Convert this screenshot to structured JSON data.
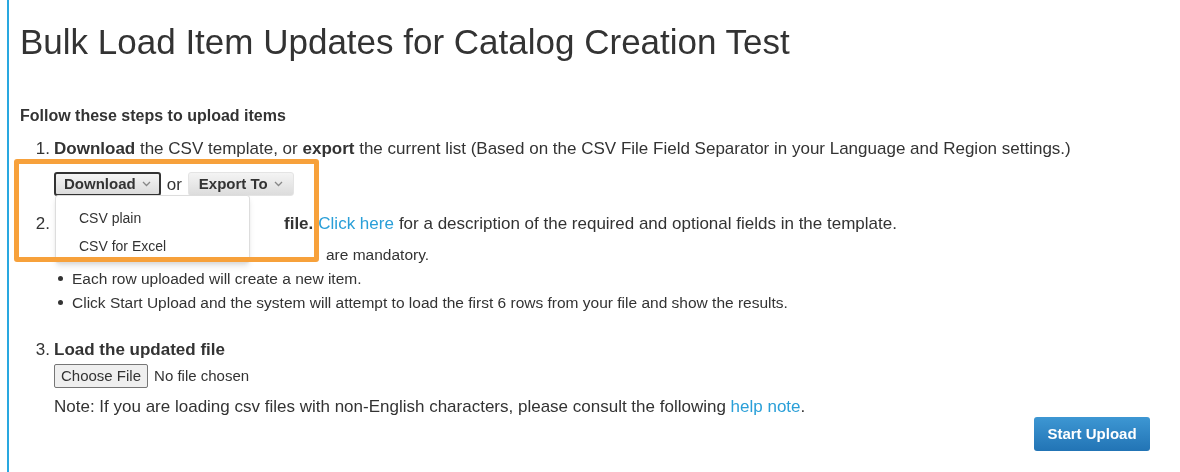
{
  "title": "Bulk Load Item Updates for Catalog Creation Test",
  "instructions_heading": "Follow these steps to upload items",
  "step1": {
    "number": "1.",
    "text": "**Download** the CSV template, or **export** the current list (Based on the CSV File Field Separator in your Language and Region settings.)",
    "download_button": {
      "label": "Download",
      "expanded": true
    },
    "or": "or",
    "export_button": {
      "label": "Export To",
      "expanded": false
    }
  },
  "step2": {
    "number": "2.",
    "heading": "file.",
    "link": "Click here",
    "text": "for a description of the required and optional fields in the template.",
    "bullets": [
      {
        "text": "are mandatory.",
        "covered": true
      },
      {
        "text": "Each row uploaded will create a new item.",
        "covered": false
      },
      {
        "text": "Click Start Upload and the system will attempt to load the first 6 rows from your file and show the results.",
        "covered": false
      }
    ]
  },
  "step3": {
    "number": "3.",
    "heading": "Load the updated file",
    "file_button": "Choose File",
    "file_status": "No file chosen",
    "note": "Note: If you are loading csv files with non-English characters, please consult the following",
    "note_link": "help note",
    "note_end": "."
  },
  "dropdown": {
    "items": [
      "CSV plain",
      "CSV for Excel"
    ]
  },
  "start_button": "Start Upload"
}
